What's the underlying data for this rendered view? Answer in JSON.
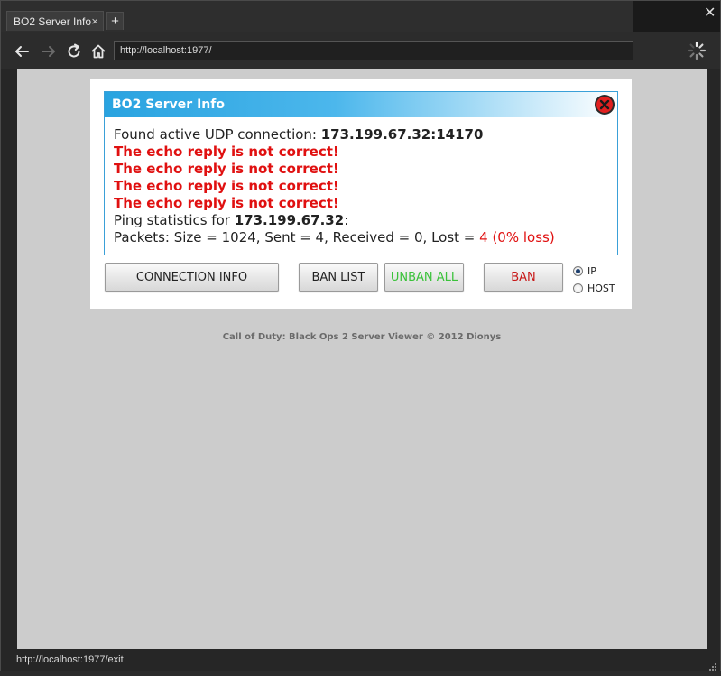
{
  "browser": {
    "tab_title": "BO2 Server Info",
    "tab_close": "×",
    "new_tab": "+",
    "window_close": "✕",
    "url": "http://localhost:1977/",
    "status_url": "http://localhost:1977/exit"
  },
  "icons": {
    "back": "back-arrow-icon",
    "forward": "forward-arrow-icon",
    "reload": "reload-icon",
    "home": "home-icon",
    "loading": "loading-spinner-icon",
    "close": "close-circle-icon",
    "grip": "resize-grip-icon"
  },
  "colors": {
    "header_blue": "#29a3e0",
    "error_red": "#e01010",
    "unban_green": "#3ac23a",
    "ban_red": "#c81818"
  },
  "dialog": {
    "title": "BO2 Server Info",
    "found_label": "Found active UDP connection: ",
    "found_address": "173.199.67.32:14170",
    "errors": [
      "The echo reply is not correct!",
      "The echo reply is not correct!",
      "The echo reply is not correct!",
      "The echo reply is not correct!"
    ],
    "ping_label": "Ping statistics for ",
    "ping_ip": "173.199.67.32",
    "ping_colon": ":",
    "packets_label": "Packets: Size = 1024, Sent = 4, Received = 0, Lost = ",
    "packets_lost": "4 (0% loss)"
  },
  "buttons": {
    "connection_info": "CONNECTION INFO",
    "ban_list": "BAN LIST",
    "unban_all": "UNBAN ALL",
    "ban": "BAN"
  },
  "radio": {
    "ip_label": "IP",
    "host_label": "HOST",
    "selected": "IP"
  },
  "footer": "Call of Duty: Black Ops 2 Server Viewer © 2012 Dionys"
}
